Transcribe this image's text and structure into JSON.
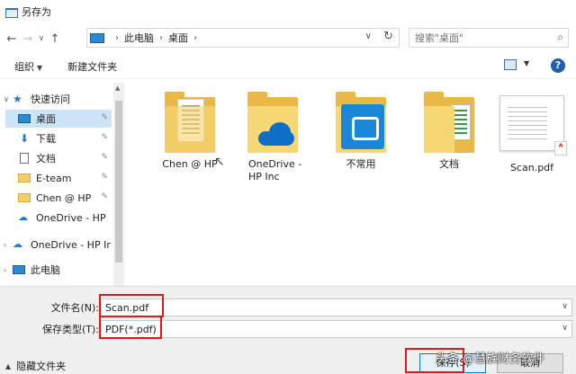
{
  "window": {
    "title": "另存为"
  },
  "address": {
    "crumbs": [
      "此电脑",
      "桌面"
    ],
    "search_placeholder": "搜索\"桌面\""
  },
  "toolbar": {
    "organize": "组织",
    "new_folder": "新建文件夹",
    "help": "?"
  },
  "nav": {
    "items": [
      {
        "label": "快速访问",
        "icon": "star-icon"
      },
      {
        "label": "桌面",
        "icon": "desktop-icon",
        "selected": true,
        "pinned": true
      },
      {
        "label": "下载",
        "icon": "download-icon",
        "pinned": true
      },
      {
        "label": "文档",
        "icon": "document-icon",
        "pinned": true
      },
      {
        "label": "E-team",
        "icon": "folder-icon",
        "pinned": true
      },
      {
        "label": "Chen @ HP",
        "icon": "folder-icon",
        "pinned": true
      },
      {
        "label": "OneDrive - HP",
        "icon": "onedrive-icon"
      },
      {
        "label": "OneDrive - HP Ir",
        "icon": "onedrive-icon"
      },
      {
        "label": "此电脑",
        "icon": "pc-icon"
      }
    ]
  },
  "files": [
    {
      "name": "Chen @ HP",
      "type": "folder"
    },
    {
      "name": "OneDrive -\nHP Inc",
      "type": "onedrive-folder"
    },
    {
      "name": "不常用",
      "type": "app-folder"
    },
    {
      "name": "文档",
      "type": "docs-folder"
    },
    {
      "name": "Scan.pdf",
      "type": "pdf"
    }
  ],
  "form": {
    "filename_label": "文件名(N):",
    "filename_value": "Scan.pdf",
    "filetype_label": "保存类型(T):",
    "filetype_value": "PDF(*.pdf)",
    "hide_folders": "隐藏文件夹",
    "save_button": "保存(S)",
    "cancel_button": "取消"
  },
  "watermark": "头条 @慧族财务软件",
  "colors": {
    "highlight": "#e0191b",
    "selection": "#cce4f7",
    "folder": "#f8d775"
  }
}
